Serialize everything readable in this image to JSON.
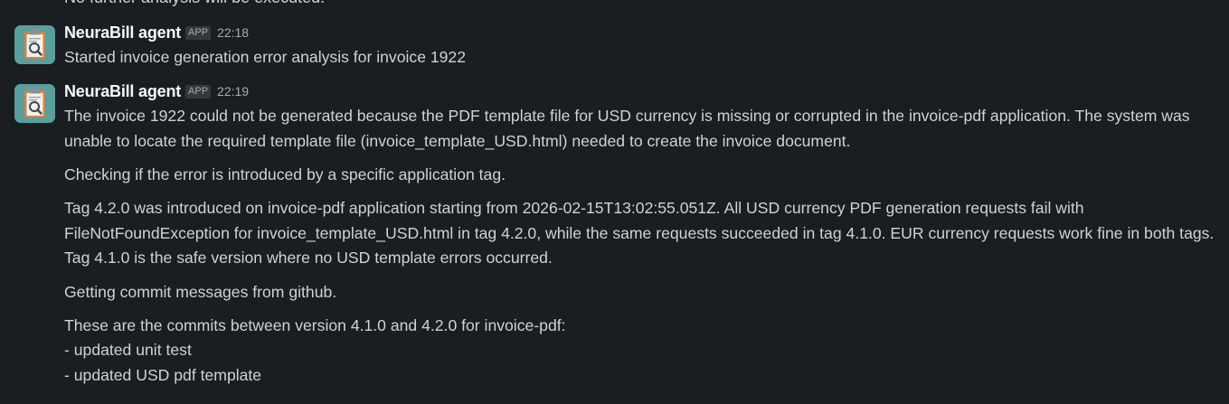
{
  "cutoff_text": "No further analysis will be executed.",
  "messages": [
    {
      "sender": "NeuraBill agent",
      "badge": "APP",
      "time": "22:18",
      "avatar_icon": "clipboard-magnifier-icon",
      "text": "Started invoice generation error analysis for invoice 1922"
    },
    {
      "sender": "NeuraBill agent",
      "badge": "APP",
      "time": "22:19",
      "avatar_icon": "clipboard-magnifier-icon",
      "paragraphs": [
        "The invoice 1922 could not be generated because the PDF template file for USD currency is missing or corrupted in the invoice-pdf application. The system was unable to locate the required template file (invoice_template_USD.html) needed to create the invoice document.",
        "Checking if the error is introduced by a specific application tag.",
        "Tag 4.2.0 was introduced on invoice-pdf application starting from 2026-02-15T13:02:55.051Z. All USD currency PDF generation requests fail with FileNotFoundException for invoice_template_USD.html in tag 4.2.0, while the same requests succeeded in tag 4.1.0. EUR currency requests work fine in both tags. Tag 4.1.0 is the safe version where no USD template errors occurred.",
        "Getting commit messages from github.",
        "These are the commits between version 4.1.0 and 4.2.0 for invoice-pdf:",
        "- updated unit test",
        "- updated USD pdf template"
      ]
    }
  ],
  "colors": {
    "background": "#1a1d21",
    "text": "#d1d2d3",
    "sender": "#f8f8f8",
    "muted": "#ababad",
    "avatar_bg": "#5a9e9d"
  }
}
